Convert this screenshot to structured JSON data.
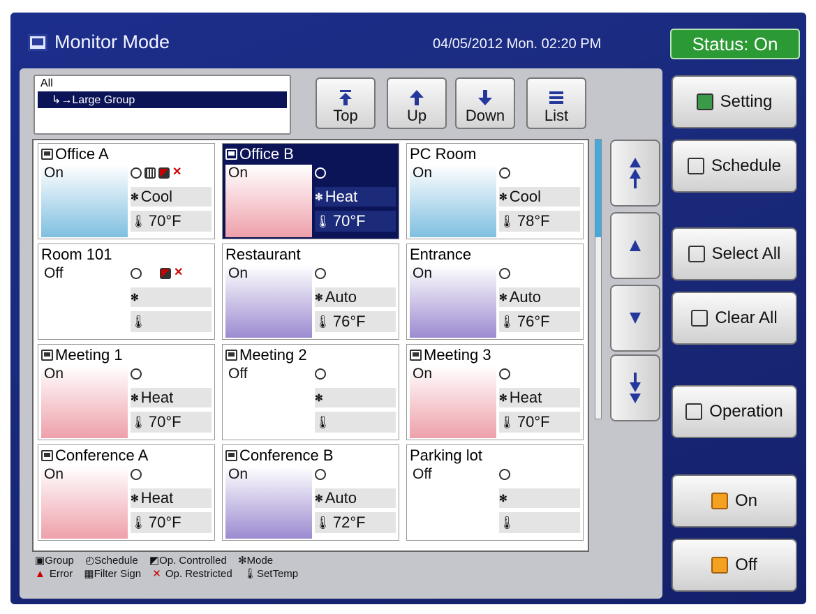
{
  "header": {
    "title": "Monitor Mode",
    "datetime": "04/05/2012  Mon. 02:20 PM",
    "status": "Status:  On"
  },
  "tree": {
    "root": "All",
    "selected": "↳→Large Group"
  },
  "nav": {
    "top": "Top",
    "up": "Up",
    "down": "Down",
    "list": "List"
  },
  "tiles": [
    {
      "name": "Office A",
      "status": "On",
      "mode": "Cool",
      "temp": "70°F",
      "group": true
    },
    {
      "name": "Office B",
      "status": "On",
      "mode": "Heat",
      "temp": "70°F",
      "group": true
    },
    {
      "name": "PC Room",
      "status": "On",
      "mode": "Cool",
      "temp": "78°F",
      "group": false
    },
    {
      "name": "Room 101",
      "status": "Off",
      "mode": "",
      "temp": "",
      "group": false
    },
    {
      "name": "Restaurant",
      "status": "On",
      "mode": "Auto",
      "temp": "76°F",
      "group": false
    },
    {
      "name": "Entrance",
      "status": "On",
      "mode": "Auto",
      "temp": "76°F",
      "group": false
    },
    {
      "name": "Meeting 1",
      "status": "On",
      "mode": "Heat",
      "temp": "70°F",
      "group": true
    },
    {
      "name": "Meeting 2",
      "status": "Off",
      "mode": "",
      "temp": "",
      "group": true
    },
    {
      "name": "Meeting 3",
      "status": "On",
      "mode": "Heat",
      "temp": "70°F",
      "group": true
    },
    {
      "name": "Conference A",
      "status": "On",
      "mode": "Heat",
      "temp": "70°F",
      "group": true
    },
    {
      "name": "Conference B",
      "status": "On",
      "mode": "Auto",
      "temp": "72°F",
      "group": true
    },
    {
      "name": "Parking lot",
      "status": "Off",
      "mode": "",
      "temp": "",
      "group": false
    }
  ],
  "legend": {
    "group": "Group",
    "schedule": "Schedule",
    "op_controlled": "Op. Controlled",
    "mode": "Mode",
    "error": "Error",
    "filter": "Filter Sign",
    "op_restricted": "Op. Restricted",
    "settemp": "SetTemp"
  },
  "side": {
    "setting": "Setting",
    "schedule": "Schedule",
    "select_all": "Select All",
    "clear_all": "Clear All",
    "operation": "Operation",
    "on": "On",
    "off": "Off"
  },
  "colors": {
    "status_green": "#2c9a34",
    "selected_tile": "#0c1458",
    "on_blue": "#7fbfe0",
    "on_pink": "#eea0aa",
    "on_purple": "#9c8ad0"
  }
}
